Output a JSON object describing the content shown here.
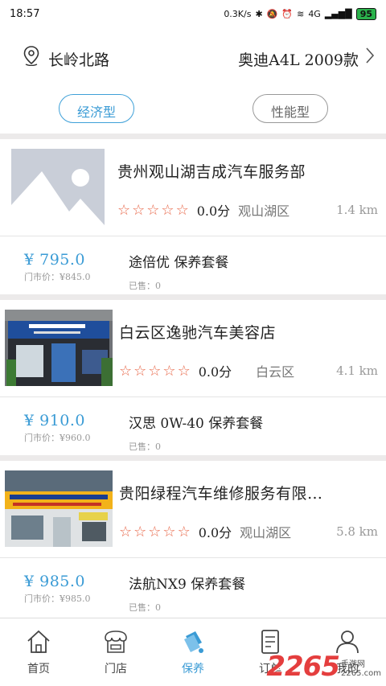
{
  "status": {
    "time": "18:57",
    "net": "0.3K/s",
    "signal": "4G",
    "battery": "95"
  },
  "location": {
    "city": "长岭北路",
    "car": "奥迪A4L 2009款"
  },
  "type_tabs": [
    {
      "label": "经济型"
    },
    {
      "label": "性能型"
    }
  ],
  "shops": [
    {
      "name": "贵州观山湖吉成汽车服务部",
      "score": "0.0分",
      "district": "观山湖区",
      "distance": "1.4 km",
      "deal": {
        "price": "¥ 795.0",
        "market": "门市价：¥845.0",
        "title": "途倍优 保养套餐",
        "sold": "已售：0"
      }
    },
    {
      "name": "白云区逸驰汽车美容店",
      "score": "0.0分",
      "district": "白云区",
      "distance": "4.1 km",
      "deal": {
        "price": "¥ 910.0",
        "market": "门市价：¥960.0",
        "title": "汉思 0W-40 保养套餐",
        "sold": "已售：0"
      }
    },
    {
      "name": "贵阳绿程汽车维修服务有限…",
      "score": "0.0分",
      "district": "观山湖区",
      "distance": "5.8 km",
      "deal": {
        "price": "¥ 985.0",
        "market": "门市价：¥985.0",
        "title": "法航NX9  保养套餐",
        "sold": "已售：0"
      }
    }
  ],
  "tabbar": [
    {
      "label": "首页",
      "icon": "home-icon"
    },
    {
      "label": "门店",
      "icon": "store-icon"
    },
    {
      "label": "保养",
      "icon": "maintenance-icon"
    },
    {
      "label": "订单",
      "icon": "order-icon"
    },
    {
      "label": "我的",
      "icon": "profile-icon"
    }
  ],
  "watermark": {
    "number": "2265",
    "sub1": "手游网",
    "sub2": "2265.com"
  },
  "colors": {
    "accent": "#3a9bd5",
    "star": "#e8684a",
    "price": "#3a9bd5"
  }
}
